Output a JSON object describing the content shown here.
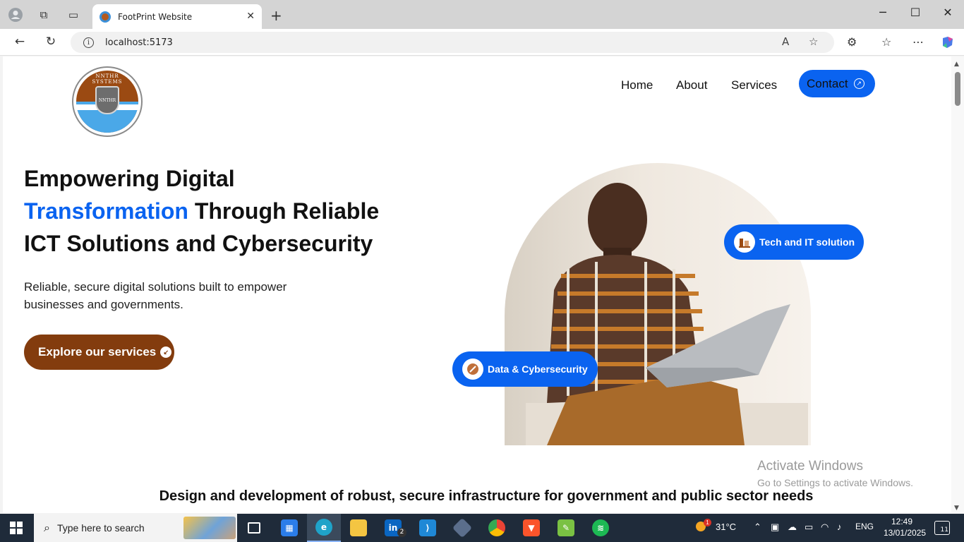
{
  "browser": {
    "tab_title": "FootPrint Website",
    "url": "localhost:5173",
    "new_tab": "+",
    "close_tab": "✕"
  },
  "site": {
    "logo_ring_text": "NNTHR SYSTEMS",
    "logo_shield_text": "NNTHR",
    "nav": {
      "home": "Home",
      "about": "About",
      "services": "Services",
      "contact": "Contact"
    },
    "hero": {
      "headline_line1": "Empowering Digital",
      "headline_highlight": "Transformation",
      "headline_line2_rest": " Through Reliable",
      "headline_line3": "ICT Solutions and Cybersecurity",
      "subtext": "Reliable, secure digital solutions built to empower businesses and governments.",
      "cta": "Explore our services",
      "badge_tech": "Tech and IT solution",
      "badge_data": "Data & Cybersecurity"
    },
    "section_heading": "Design and development of robust, secure infrastructure for government and public sector needs"
  },
  "watermark": {
    "line1": "Activate Windows",
    "line2": "Go to Settings to activate Windows."
  },
  "taskbar": {
    "search_placeholder": "Type here to search",
    "weather": "31°C",
    "language": "ENG",
    "time": "12:49",
    "date": "13/01/2025",
    "linkedin_badge": "2",
    "notification_count": "11",
    "weather_badge": "1"
  },
  "colors": {
    "accent_blue": "#0a63f0",
    "brand_brown": "#833c0e"
  }
}
